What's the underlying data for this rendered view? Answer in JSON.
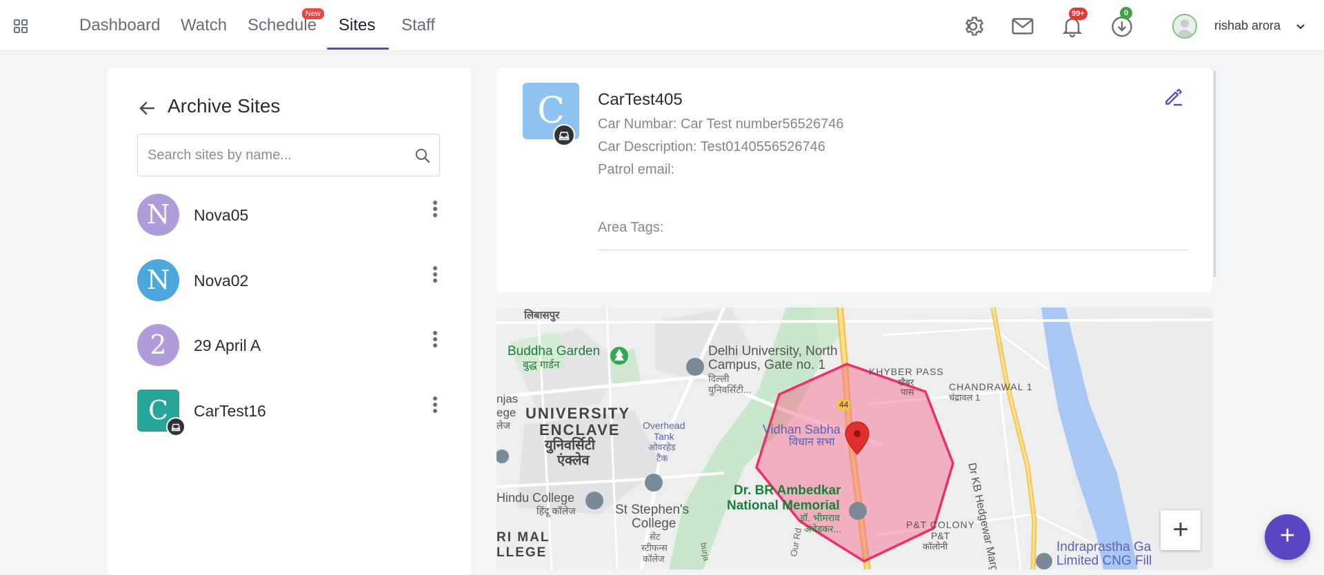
{
  "nav": {
    "tabs": [
      {
        "label": "Dashboard"
      },
      {
        "label": "Watch"
      },
      {
        "label": "Schedule",
        "badge": "New"
      },
      {
        "label": "Sites",
        "active": true
      },
      {
        "label": "Staff"
      }
    ],
    "notifications_badge": "99+",
    "downloads_badge": "0",
    "user_name": "rishab arora"
  },
  "sites_panel": {
    "title": "Archive Sites",
    "search_placeholder": "Search sites by name...",
    "sites": [
      {
        "initial": "N",
        "name": "Nova05",
        "color": "#b19bd9",
        "shape": "circle",
        "car": false
      },
      {
        "initial": "N",
        "name": "Nova02",
        "color": "#4aa8dd",
        "shape": "circle",
        "car": false
      },
      {
        "initial": "2",
        "name": "29 April A",
        "color": "#b19bd9",
        "shape": "circle",
        "car": false
      },
      {
        "initial": "C",
        "name": "CarTest16",
        "color": "#26a69a",
        "shape": "square",
        "car": true
      }
    ]
  },
  "detail": {
    "initial": "C",
    "title": "CarTest405",
    "car_number": "Car Numbar: Car Test number56526746",
    "car_description": "Car Description: Test0140556526746",
    "patrol_email": "Patrol email:",
    "area_tags": "Area Tags:"
  },
  "map": {
    "labels": {
      "libaspur": "लिबासपुर",
      "buddha_garden": "Buddha Garden",
      "buddha_garden_hi": "बुद्ध गार्डन",
      "du_line1": "Delhi University, North",
      "du_line2": "Campus, Gate no. 1",
      "du_hi1": "दिल्ली",
      "du_hi2": "युनिवर्सिटी...",
      "khyber": "KHYBER PASS",
      "khyber_hi1": "खैबर",
      "khyber_hi2": "पास",
      "chandrawal": "CHANDRAWAL 1",
      "chandrawal_hi": "चंद्रावल 1",
      "hedgewar": "Dr KB Hedgewar Marg",
      "university1": "UNIVERSITY",
      "university2": "ENCLAVE",
      "university_hi1": "युनिवर्सिटी",
      "university_hi2": "एंक्लेव",
      "njas": "njas",
      "ege": "ege",
      "jej": "लेज",
      "overhead1": "Overhead",
      "overhead2": "Tank",
      "overhead_hi1": "ओवरहेड",
      "overhead_hi2": "टैंक",
      "vidhan": "Vidhan Sabha",
      "vidhan_hi": "विधान सभा",
      "road_44": "44",
      "hindu_college": "Hindu College",
      "hindu_college_hi": "हिंदू कॉलेज",
      "st_stephens1": "St Stephen's",
      "st_stephens2": "College",
      "st_stephens_hi1": "सेंट",
      "st_stephens_hi2": "स्टीफन्स",
      "st_stephens_hi3": "कॉलेज",
      "ambedkar1": "Dr. BR Ambedkar",
      "ambedkar2": "National Memorial",
      "ambedkar_hi1": "डॉ. भीमराव",
      "ambedkar_hi2": "अंबेडकर...",
      "pt_colony": "P&T COLONY",
      "pt_colony_hi1": "P&T",
      "pt_colony_hi2": "कॉलोनी",
      "ri_mal": "RI MAL",
      "llege": "LLEGE",
      "indraprastha1": "Indraprastha Ga",
      "indraprastha2": "Limited CNG Fill",
      "ourrd": "Our Rd",
      "burja": "burja"
    },
    "zoom_in": "+"
  },
  "fab_label": "+"
}
